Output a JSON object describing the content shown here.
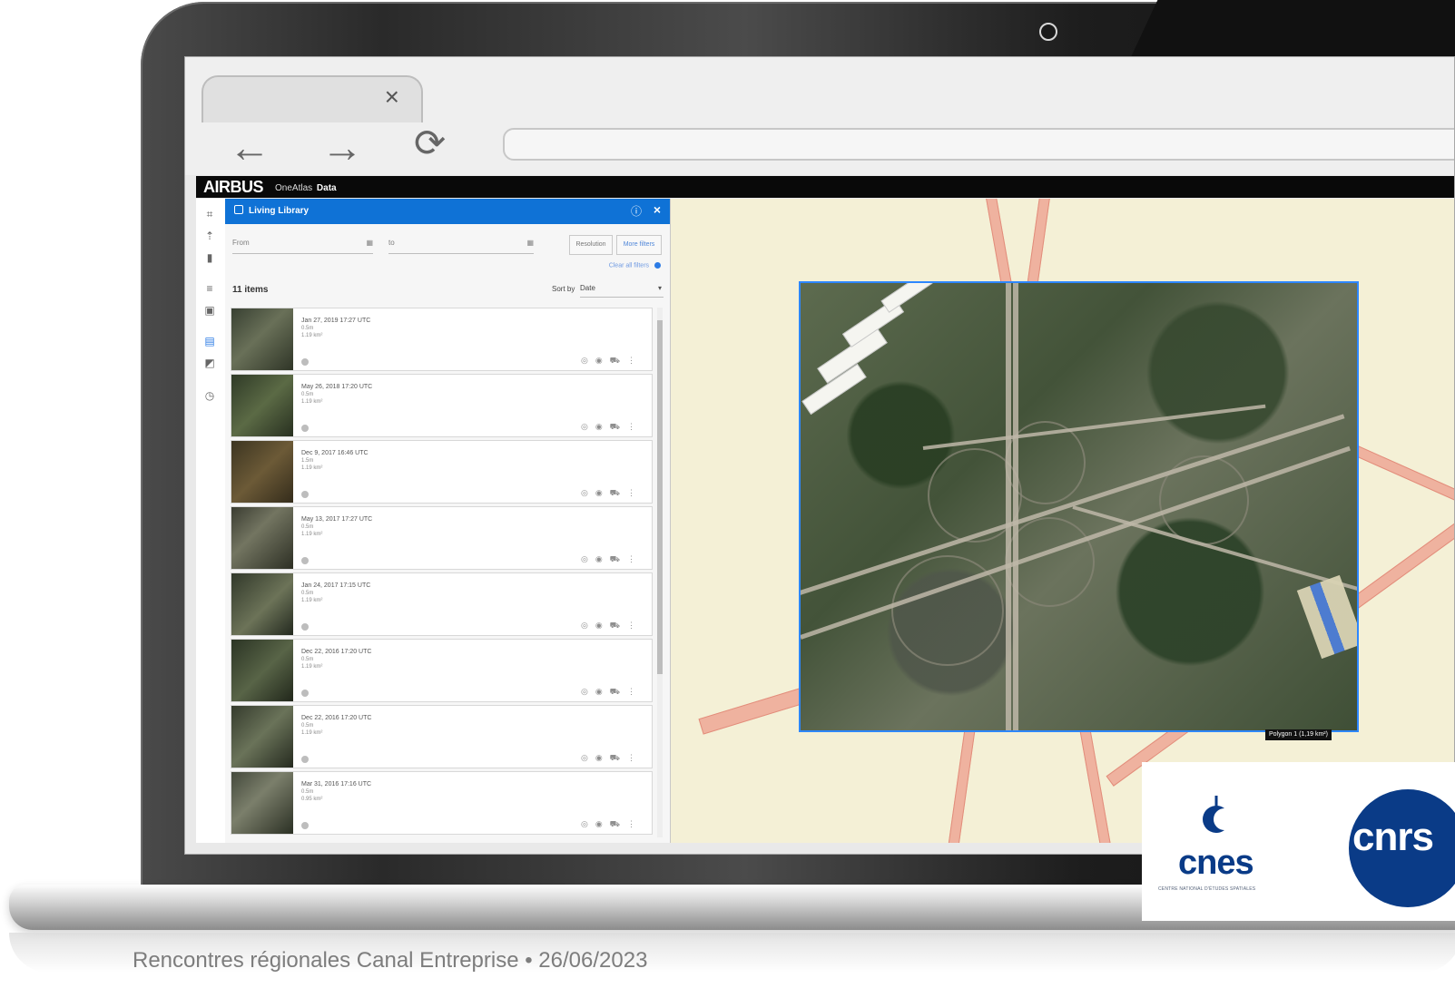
{
  "browser": {
    "tab_close": "×"
  },
  "app": {
    "brand_main": "AIRBUS",
    "brand_sub_1": "OneAtlas",
    "brand_sub_2": "Data"
  },
  "panel": {
    "title": "Living Library",
    "from_label": "From",
    "to_label": "to",
    "resolution_label": "Resolution",
    "more_filters_label": "More filters",
    "clear_filters_label": "Clear all filters",
    "items_count": "11 items",
    "sort_label": "Sort by",
    "sort_value": "Date",
    "items": [
      {
        "date": "Jan 27, 2019 17:27 UTC",
        "resolution": "0.5m",
        "area": "1.19 km²"
      },
      {
        "date": "May 26, 2018 17:20 UTC",
        "resolution": "0.5m",
        "area": "1.19 km²"
      },
      {
        "date": "Dec 9, 2017 16:46 UTC",
        "resolution": "1.5m",
        "area": "1.19 km²"
      },
      {
        "date": "May 13, 2017 17:27 UTC",
        "resolution": "0.5m",
        "area": "1.19 km²"
      },
      {
        "date": "Jan 24, 2017 17:15 UTC",
        "resolution": "0.5m",
        "area": "1.19 km²"
      },
      {
        "date": "Dec 22, 2016 17:20 UTC",
        "resolution": "0.5m",
        "area": "1.19 km²"
      },
      {
        "date": "Dec 22, 2016 17:20 UTC",
        "resolution": "0.5m",
        "area": "1.19 km²"
      },
      {
        "date": "Mar 31, 2016 17:16 UTC",
        "resolution": "0.5m",
        "area": "0.95 km²"
      }
    ]
  },
  "map": {
    "polygon_label": "Polygon 1 (1,19 km²)"
  },
  "logos": {
    "cnes": "cnes",
    "cnes_sub": "CENTRE NATIONAL D'ÉTUDES SPATIALES",
    "cnrs": "cnrs"
  },
  "footer": {
    "text": "Rencontres régionales Canal Entreprise • 26/06/2023"
  }
}
